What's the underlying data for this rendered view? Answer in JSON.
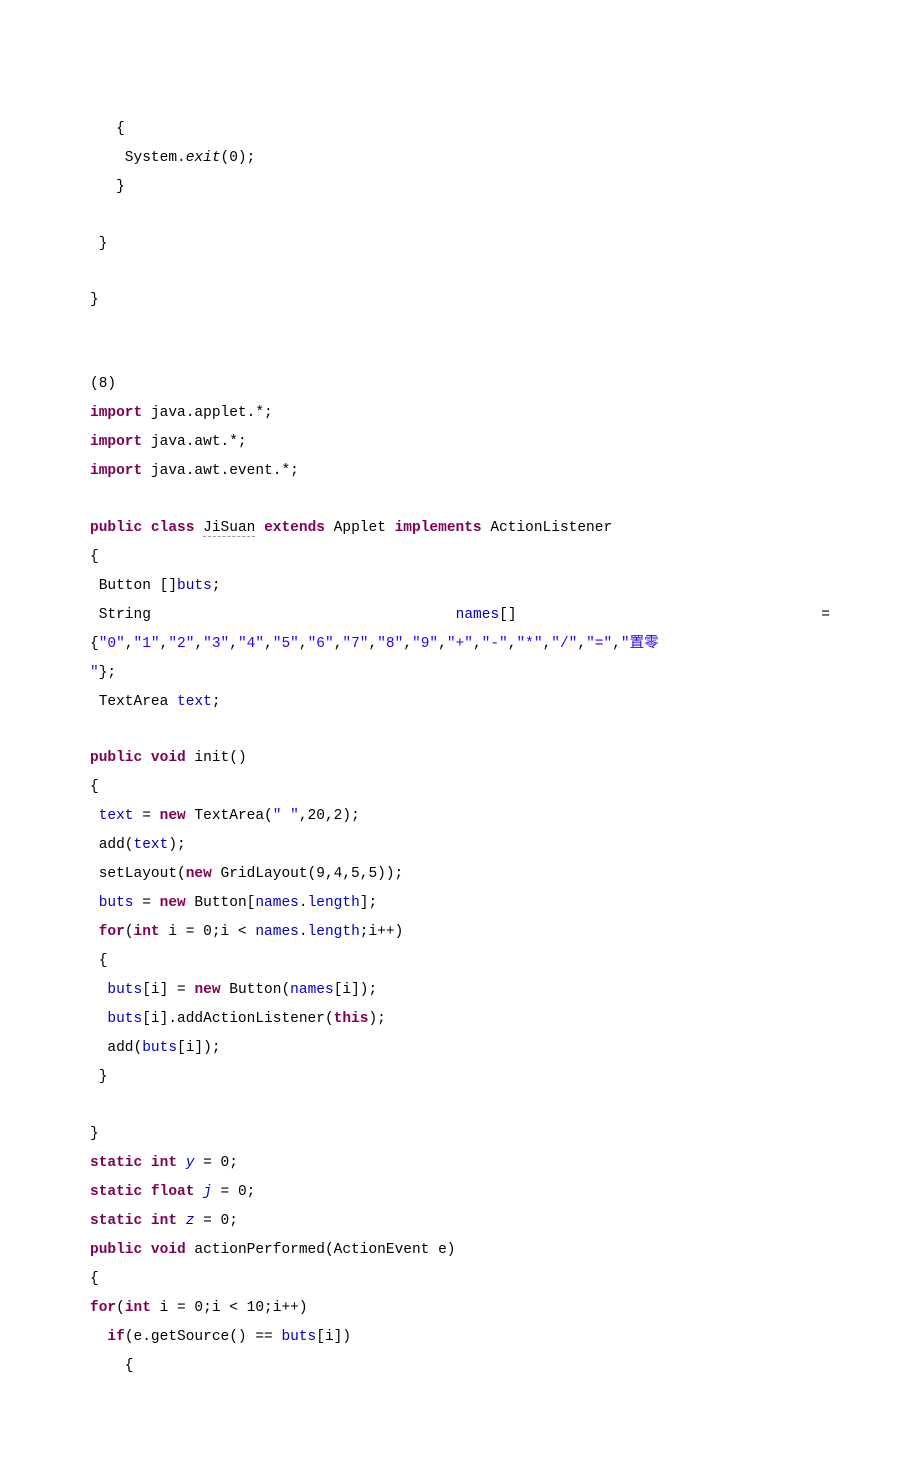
{
  "top_block": {
    "l1": "   {",
    "l2": "    System.",
    "l2_italic": "exit",
    "l2_tail": "(0);",
    "l3": "   }",
    "l4": " }",
    "l5": "}"
  },
  "section_marker": "(8)",
  "imports": {
    "kw": "import",
    "i1": " java.applet.*;",
    "i2": " java.awt.*;",
    "i3": " java.awt.event.*;"
  },
  "class_decl": {
    "p1": "public",
    "p2": "class",
    "name": "JiSuan",
    "p3": "extends",
    "applet": " Applet ",
    "p4": "implements",
    "tail": " ActionListener"
  },
  "fields": {
    "brace": "{",
    "btn_pre": " Button []",
    "btn_field": "buts",
    "btn_tail": ";",
    "str_left": " String ",
    "str_mid": "names",
    "str_mid2": "[] ",
    "str_right": "=",
    "names_line1_a": "{",
    "names_line1_b": "\"0\"",
    "names_line1_c": ",",
    "names_vals": [
      "\"1\"",
      "\"2\"",
      "\"3\"",
      "\"4\"",
      "\"5\"",
      "\"6\"",
      "\"7\"",
      "\"8\"",
      "\"9\"",
      "\"+\"",
      "\"-\"",
      "\"*\"",
      "\"/\"",
      "\"=\""
    ],
    "names_last": "\"置零",
    "names_line2_a": "\"",
    "names_line2_b": "};",
    "text_pre": " TextArea ",
    "text_field": "text",
    "text_tail": ";"
  },
  "init": {
    "sig_pre": "public",
    "sig_void": "void",
    "sig_name": " init()",
    "brace": "{",
    "l1_a": " ",
    "l1_field": "text",
    "l1_b": " = ",
    "l1_new": "new",
    "l1_c": " TextArea(",
    "l1_str": "\" \"",
    "l1_d": ",20,2);",
    "l2_a": " add(",
    "l2_field": "text",
    "l2_b": ");",
    "l3_a": " setLayout(",
    "l3_new": "new",
    "l3_b": " GridLayout(9,4,5,5));",
    "l4_a": " ",
    "l4_field": "buts",
    "l4_b": " = ",
    "l4_new": "new",
    "l4_c": " Button[",
    "l4_field2": "names",
    "l4_d": ".",
    "l4_field3": "length",
    "l4_e": "];",
    "l5_a": " ",
    "l5_for": "for",
    "l5_b": "(",
    "l5_int": "int",
    "l5_c": " i = 0;i < ",
    "l5_field": "names",
    "l5_d": ".",
    "l5_field2": "length",
    "l5_e": ";i++)",
    "l6": " {",
    "l7_a": "  ",
    "l7_field": "buts",
    "l7_b": "[i] = ",
    "l7_new": "new",
    "l7_c": " Button(",
    "l7_field2": "names",
    "l7_d": "[i]);",
    "l8_a": "  ",
    "l8_field": "buts",
    "l8_b": "[i].addActionListener(",
    "l8_this": "this",
    "l8_c": ");",
    "l9_a": "  add(",
    "l9_field": "buts",
    "l9_b": "[i]);",
    "l10": " }",
    "close": "}"
  },
  "statics": {
    "s1_kw": "static",
    "s1_int": "int",
    "s1_mid": " ",
    "s1_var": "y",
    "s1_tail": " = 0;",
    "s2_kw": "static",
    "s2_float": "float",
    "s2_mid": " ",
    "s2_var": "j",
    "s2_tail": " = 0;",
    "s3_kw": "static",
    "s3_int": "int",
    "s3_mid": " ",
    "s3_var": "z",
    "s3_tail": " = 0;"
  },
  "action": {
    "sig_pub": "public",
    "sig_void": "void",
    "sig_name": " actionPerformed(ActionEvent e)",
    "brace": "{",
    "for_kw": "for",
    "for_a": "(",
    "for_int": "int",
    "for_b": " i = 0;i < 10;i++)",
    "if_pre": "  ",
    "if_kw": "if",
    "if_a": "(e.getSource() == ",
    "if_field": "buts",
    "if_b": "[i])",
    "if_brace": "    {"
  }
}
